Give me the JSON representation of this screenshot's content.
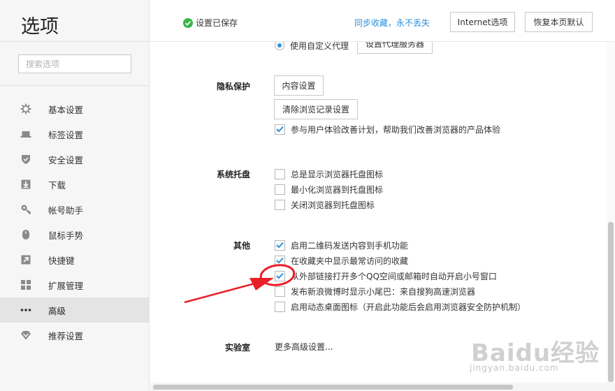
{
  "app": {
    "title": "选项"
  },
  "search": {
    "placeholder": "搜索选项"
  },
  "sidebar": {
    "items": [
      {
        "label": "基本设置",
        "icon": "gear-icon"
      },
      {
        "label": "标签设置",
        "icon": "tab-icon"
      },
      {
        "label": "安全设置",
        "icon": "shield-icon"
      },
      {
        "label": "下载",
        "icon": "download-icon"
      },
      {
        "label": "帐号助手",
        "icon": "key-icon"
      },
      {
        "label": "鼠标手势",
        "icon": "mouse-icon"
      },
      {
        "label": "快捷键",
        "icon": "shortcut-arrow-icon"
      },
      {
        "label": "扩展管理",
        "icon": "grid-icon"
      },
      {
        "label": "高级",
        "icon": "more-dots-icon",
        "active": true
      },
      {
        "label": "推荐设置",
        "icon": "diamond-icon"
      }
    ]
  },
  "header": {
    "status_text": "设置已保存",
    "sync_link": "同步收藏，永不丢失",
    "internet_button": "Internet选项",
    "restore_button": "恢复本页默认"
  },
  "proxy": {
    "radio_label": "使用自定义代理",
    "button": "设置代理服务器"
  },
  "privacy": {
    "label": "隐私保护",
    "content_button": "内容设置",
    "clear_button": "清除浏览记录设置",
    "options": [
      {
        "label": "参与用户体验改善计划，帮助我们改善浏览器的产品体验",
        "checked": true
      }
    ]
  },
  "tray": {
    "label": "系统托盘",
    "options": [
      {
        "label": "总是显示浏览器托盘图标",
        "checked": false
      },
      {
        "label": "最小化浏览器到托盘图标",
        "checked": false
      },
      {
        "label": "关闭浏览器到托盘图标",
        "checked": false
      }
    ]
  },
  "other": {
    "label": "其他",
    "options": [
      {
        "label": "启用二维码发送内容到手机功能",
        "checked": true
      },
      {
        "label": "在收藏夹中显示最常访问的收藏",
        "checked": true
      },
      {
        "label": "从外部链接打开多个QQ空间或邮箱时自动开启小号窗口",
        "checked": true
      },
      {
        "label": "发布新浪微博时显示小尾巴：来自搜狗高速浏览器",
        "checked": false
      },
      {
        "label": "启用动态桌面图标（开启此功能后会启用浏览器安全防护机制）",
        "checked": false
      }
    ]
  },
  "lab": {
    "label": "实验室",
    "link": "更多高级设置..."
  },
  "watermark": {
    "logo": "Baidu经验",
    "url": "jingyan.baidu.com"
  },
  "colors": {
    "accent": "#2b90dc",
    "check": "#2b90dc",
    "annotation": "#e8202a",
    "status_ok": "#3ab54a"
  }
}
